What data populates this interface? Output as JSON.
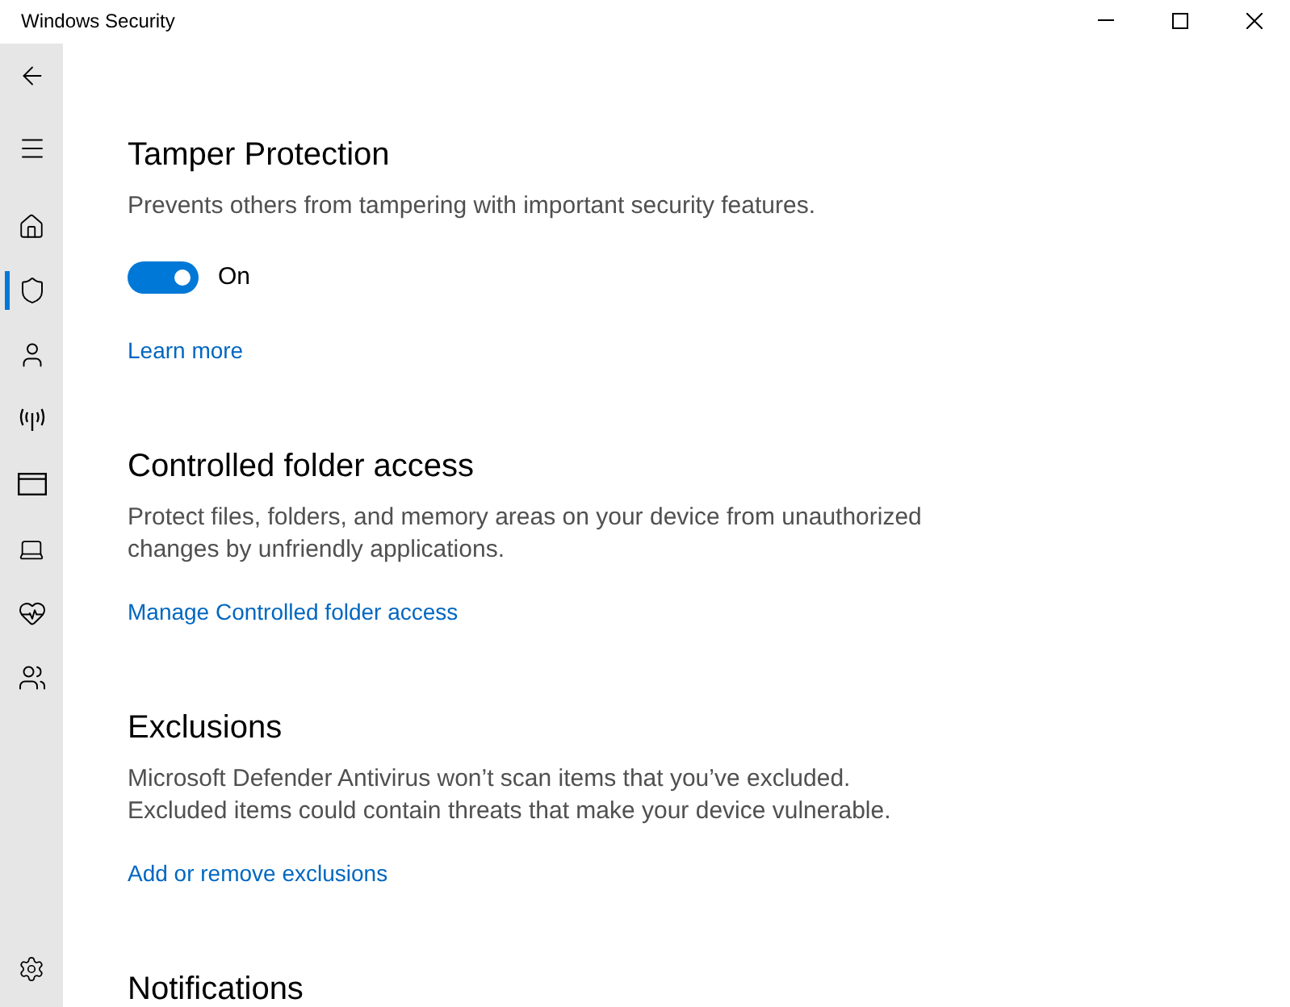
{
  "window": {
    "title": "Windows Security"
  },
  "sidebar": {
    "items": [
      {
        "selected": false
      },
      {
        "selected": true
      },
      {
        "selected": false
      },
      {
        "selected": false
      },
      {
        "selected": false
      },
      {
        "selected": false
      },
      {
        "selected": false
      },
      {
        "selected": false
      }
    ]
  },
  "sections": [
    {
      "title": "Tamper Protection",
      "description": "Prevents others from tampering with important security features.",
      "toggle": {
        "on": true,
        "label": "On"
      },
      "link": "Learn more"
    },
    {
      "title": "Controlled folder access",
      "description": "Protect files, folders, and memory areas on your device from unauthorized\nchanges by unfriendly applications.",
      "link": "Manage Controlled folder access"
    },
    {
      "title": "Exclusions",
      "description": "Microsoft Defender Antivirus won’t scan items that you’ve excluded.\nExcluded items could contain threats that make your device vulnerable.",
      "link": "Add or remove exclusions"
    },
    {
      "title": "Notifications"
    }
  ]
}
